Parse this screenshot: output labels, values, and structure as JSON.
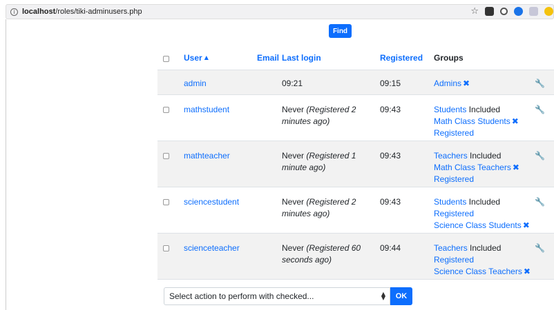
{
  "browser": {
    "url_host": "localhost",
    "url_path": "/roles/tiki-adminusers.php"
  },
  "search": {
    "find_label": "Find"
  },
  "table": {
    "headers": {
      "user": "User",
      "email": "Email",
      "last_login": "Last login",
      "registered": "Registered",
      "groups": "Groups"
    },
    "rows": [
      {
        "user": "admin",
        "last_login": "09:21",
        "last_login_note": "",
        "registered": "09:15",
        "groups": [
          {
            "name": "Admins",
            "suffix": "",
            "removable": true
          }
        ]
      },
      {
        "user": "mathstudent",
        "last_login": "Never",
        "last_login_note": "(Registered 2 minutes ago)",
        "registered": "09:43",
        "groups": [
          {
            "name": "Students",
            "suffix": "Included",
            "removable": false
          },
          {
            "name": "Math Class Students",
            "suffix": "",
            "removable": true
          },
          {
            "name": "Registered",
            "suffix": "",
            "removable": false
          }
        ]
      },
      {
        "user": "mathteacher",
        "last_login": "Never",
        "last_login_note": "(Registered 1 minute ago)",
        "registered": "09:43",
        "groups": [
          {
            "name": "Teachers",
            "suffix": "Included",
            "removable": false
          },
          {
            "name": "Math Class Teachers",
            "suffix": "",
            "removable": true
          },
          {
            "name": "Registered",
            "suffix": "",
            "removable": false
          }
        ]
      },
      {
        "user": "sciencestudent",
        "last_login": "Never",
        "last_login_note": "(Registered 2 minutes ago)",
        "registered": "09:43",
        "groups": [
          {
            "name": "Students",
            "suffix": "Included",
            "removable": false
          },
          {
            "name": "Registered",
            "suffix": "",
            "removable": false
          },
          {
            "name": "Science Class Students",
            "suffix": "",
            "removable": true
          }
        ]
      },
      {
        "user": "scienceteacher",
        "last_login": "Never",
        "last_login_note": "(Registered 60 seconds ago)",
        "registered": "09:44",
        "groups": [
          {
            "name": "Teachers",
            "suffix": "Included",
            "removable": false
          },
          {
            "name": "Registered",
            "suffix": "",
            "removable": false
          },
          {
            "name": "Science Class Teachers",
            "suffix": "",
            "removable": true
          }
        ]
      }
    ]
  },
  "bulk_action": {
    "placeholder": "Select action to perform with checked...",
    "ok_label": "OK"
  },
  "icons": {
    "sort_asc": "caret-up-icon",
    "remove_group": "x-icon",
    "edit": "wrench-icon",
    "info": "info-icon"
  },
  "colors": {
    "link": "#0d6efd",
    "row_alt": "#f2f2f2"
  }
}
